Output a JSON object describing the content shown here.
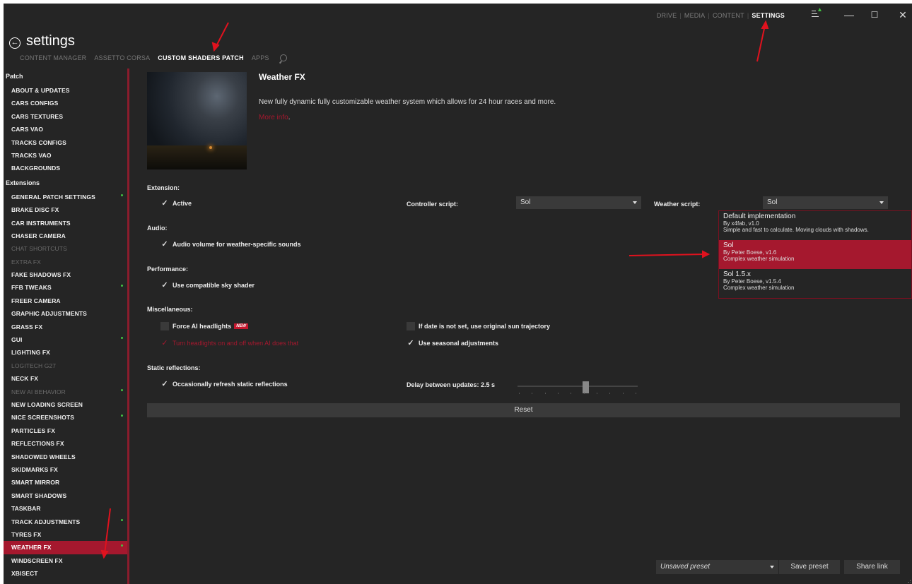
{
  "titlebar": {
    "nav": [
      {
        "label": "DRIVE",
        "active": false
      },
      {
        "label": "MEDIA",
        "active": false
      },
      {
        "label": "CONTENT",
        "active": false
      },
      {
        "label": "SETTINGS",
        "active": true
      }
    ],
    "minimize": "—",
    "maximize": "☐",
    "close": "✕"
  },
  "header": {
    "back": "←",
    "title": "settings",
    "tabs": [
      {
        "label": "CONTENT MANAGER",
        "active": false
      },
      {
        "label": "ASSETTO CORSA",
        "active": false
      },
      {
        "label": "CUSTOM SHADERS PATCH",
        "active": true
      },
      {
        "label": "APPS",
        "active": false
      }
    ]
  },
  "sidebar": {
    "group1": "Patch",
    "patch_items": [
      "ABOUT & UPDATES",
      "CARS CONFIGS",
      "CARS TEXTURES",
      "CARS VAO",
      "TRACKS CONFIGS",
      "TRACKS VAO",
      "BACKGROUNDS"
    ],
    "group2": "Extensions",
    "ext_items": [
      {
        "label": "GENERAL PATCH SETTINGS",
        "dot": true
      },
      {
        "label": "BRAKE DISC FX"
      },
      {
        "label": "CAR INSTRUMENTS"
      },
      {
        "label": "CHASER CAMERA"
      },
      {
        "label": "CHAT SHORTCUTS",
        "dim": true
      },
      {
        "label": "EXTRA FX",
        "dim": true
      },
      {
        "label": "FAKE SHADOWS FX"
      },
      {
        "label": "FFB TWEAKS",
        "dot": true
      },
      {
        "label": "FREER CAMERA"
      },
      {
        "label": "GRAPHIC ADJUSTMENTS"
      },
      {
        "label": "GRASS FX"
      },
      {
        "label": "GUI",
        "dot": true
      },
      {
        "label": "LIGHTING FX"
      },
      {
        "label": "LOGITECH G27",
        "dim": true
      },
      {
        "label": "NECK FX"
      },
      {
        "label": "NEW AI BEHAVIOR",
        "dim": true,
        "dot": true
      },
      {
        "label": "NEW LOADING SCREEN"
      },
      {
        "label": "NICE SCREENSHOTS",
        "dot": true
      },
      {
        "label": "PARTICLES FX"
      },
      {
        "label": "REFLECTIONS FX"
      },
      {
        "label": "SHADOWED WHEELS"
      },
      {
        "label": "SKIDMARKS FX"
      },
      {
        "label": "SMART MIRROR"
      },
      {
        "label": "SMART SHADOWS"
      },
      {
        "label": "TASKBAR"
      },
      {
        "label": "TRACK ADJUSTMENTS",
        "dot": true
      },
      {
        "label": "TYRES FX"
      },
      {
        "label": "WEATHER FX",
        "selected": true,
        "dot": true
      },
      {
        "label": "WINDSCREEN FX"
      },
      {
        "label": "XBISECT"
      }
    ]
  },
  "main": {
    "title": "Weather FX",
    "description": "New fully dynamic fully customizable weather system which allows for 24 hour races and more.",
    "more_info": "More info",
    "more_info_dot": ".",
    "sections": {
      "extension": "Extension:",
      "audio": "Audio:",
      "performance": "Performance:",
      "misc": "Miscellaneous:",
      "static": "Static reflections:"
    },
    "checks": {
      "active": {
        "label": "Active",
        "checked": true
      },
      "audio_volume": {
        "label": "Audio volume for weather-specific sounds",
        "checked": true
      },
      "compatible_sky": {
        "label": "Use compatible sky shader",
        "checked": true
      },
      "force_ai": {
        "label": "Force AI headlights",
        "checked": false,
        "badge": "NEW"
      },
      "turn_headlights": {
        "label": "Turn headlights on and off when AI does that",
        "checked": true
      },
      "sun_trajectory": {
        "label": "If date is not set, use original sun trajectory",
        "checked": false
      },
      "seasonal": {
        "label": "Use seasonal adjustments",
        "checked": true
      },
      "refresh_static": {
        "label": "Occasionally refresh static reflections",
        "checked": true
      }
    },
    "controller_script_label": "Controller script:",
    "controller_script_value": "Sol",
    "weather_script_label": "Weather script:",
    "weather_script_value": "Sol",
    "weather_options": [
      {
        "title": "Default implementation",
        "author": "By x4fab, v1.0",
        "desc": "Simple and fast to calculate. Moving clouds with shadows."
      },
      {
        "title": "Sol",
        "author": "By Peter Boese, v1.6",
        "desc": "Complex weather simulation",
        "selected": true
      },
      {
        "title": "Sol 1.5.x",
        "author": "By Peter Boese, v1.5.4",
        "desc": "Complex weather simulation"
      }
    ],
    "delay_label": "Delay between updates: 2.5 s",
    "delay_fraction": 0.57,
    "reset": "Reset"
  },
  "footer": {
    "preset": "Unsaved preset",
    "save_preset": "Save preset",
    "share_link": "Share link"
  },
  "colors": {
    "accent": "#a5182e",
    "background": "#252525",
    "indicator": "#42c342"
  }
}
